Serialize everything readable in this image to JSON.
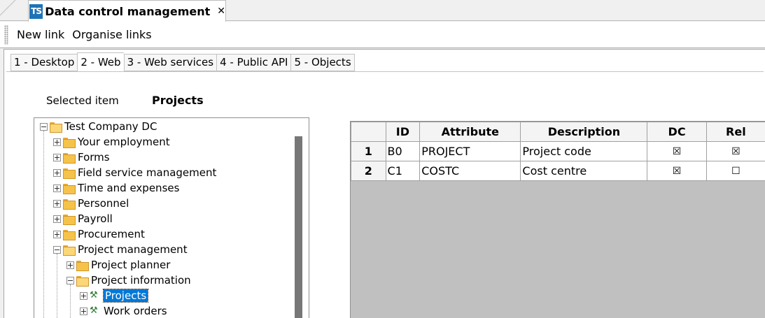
{
  "document_tab": {
    "logo": "TS",
    "title": "Data control management",
    "close": "✕"
  },
  "toolbar": {
    "new_link": "New link",
    "organise_links": "Organise links"
  },
  "tabs": [
    {
      "label": "1 - Desktop",
      "active": false
    },
    {
      "label": "2 - Web",
      "active": true
    },
    {
      "label": "3 - Web services",
      "active": false
    },
    {
      "label": "4 - Public API",
      "active": false
    },
    {
      "label": "5 - Objects",
      "active": false
    }
  ],
  "selected": {
    "label": "Selected item",
    "value": "Projects"
  },
  "tree": {
    "root": "Test Company DC",
    "items": [
      {
        "label": "Your employment"
      },
      {
        "label": "Forms"
      },
      {
        "label": "Field service management"
      },
      {
        "label": "Time and expenses"
      },
      {
        "label": "Personnel"
      },
      {
        "label": "Payroll"
      },
      {
        "label": "Procurement"
      },
      {
        "label": "Project management"
      },
      {
        "label": "Project planner"
      },
      {
        "label": "Project information"
      },
      {
        "label": "Projects"
      },
      {
        "label": "Work orders"
      }
    ]
  },
  "grid": {
    "headers": {
      "id": "ID",
      "attribute": "Attribute",
      "description": "Description",
      "dc": "DC",
      "rel": "Rel"
    },
    "rows": [
      {
        "num": "1",
        "id": "B0",
        "attribute": "PROJECT",
        "description": "Project code",
        "dc": "☒",
        "rel": "☒"
      },
      {
        "num": "2",
        "id": "C1",
        "attribute": "COSTC",
        "description": "Cost centre",
        "dc": "☒",
        "rel": "☐"
      }
    ]
  }
}
